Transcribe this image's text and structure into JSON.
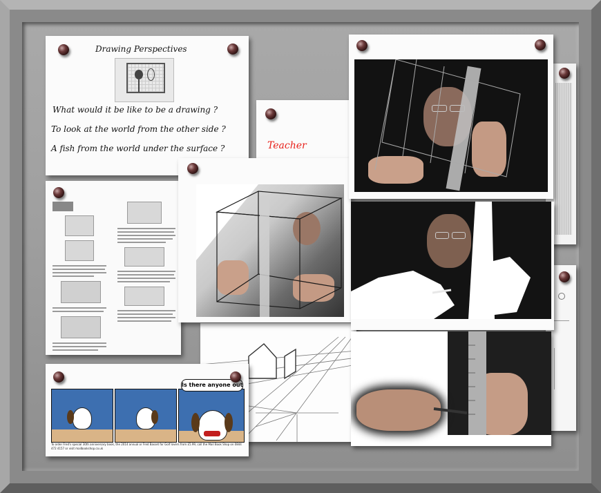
{
  "card_drawing_perspectives": {
    "title": "Drawing Perspectives",
    "lines": [
      "What would it be like to be a drawing ?",
      "To look at the world from the other side ?",
      "A fish from the world under the surface ?"
    ]
  },
  "card_teacher": {
    "label": "Teacher"
  },
  "comic": {
    "speech": "Is there anyone out there?!",
    "caption": "To order Fred's special 30th anniversary book, the 2014 annual or Fred Basset for Golf lovers from £5.99, call the Mail Book Shop on 0844 472 4157 or visit mailbookshop.co.uk"
  },
  "colors": {
    "teacher_text": "#e8201a",
    "board": "#a0a0a0",
    "pin": "#5a2a2a"
  }
}
